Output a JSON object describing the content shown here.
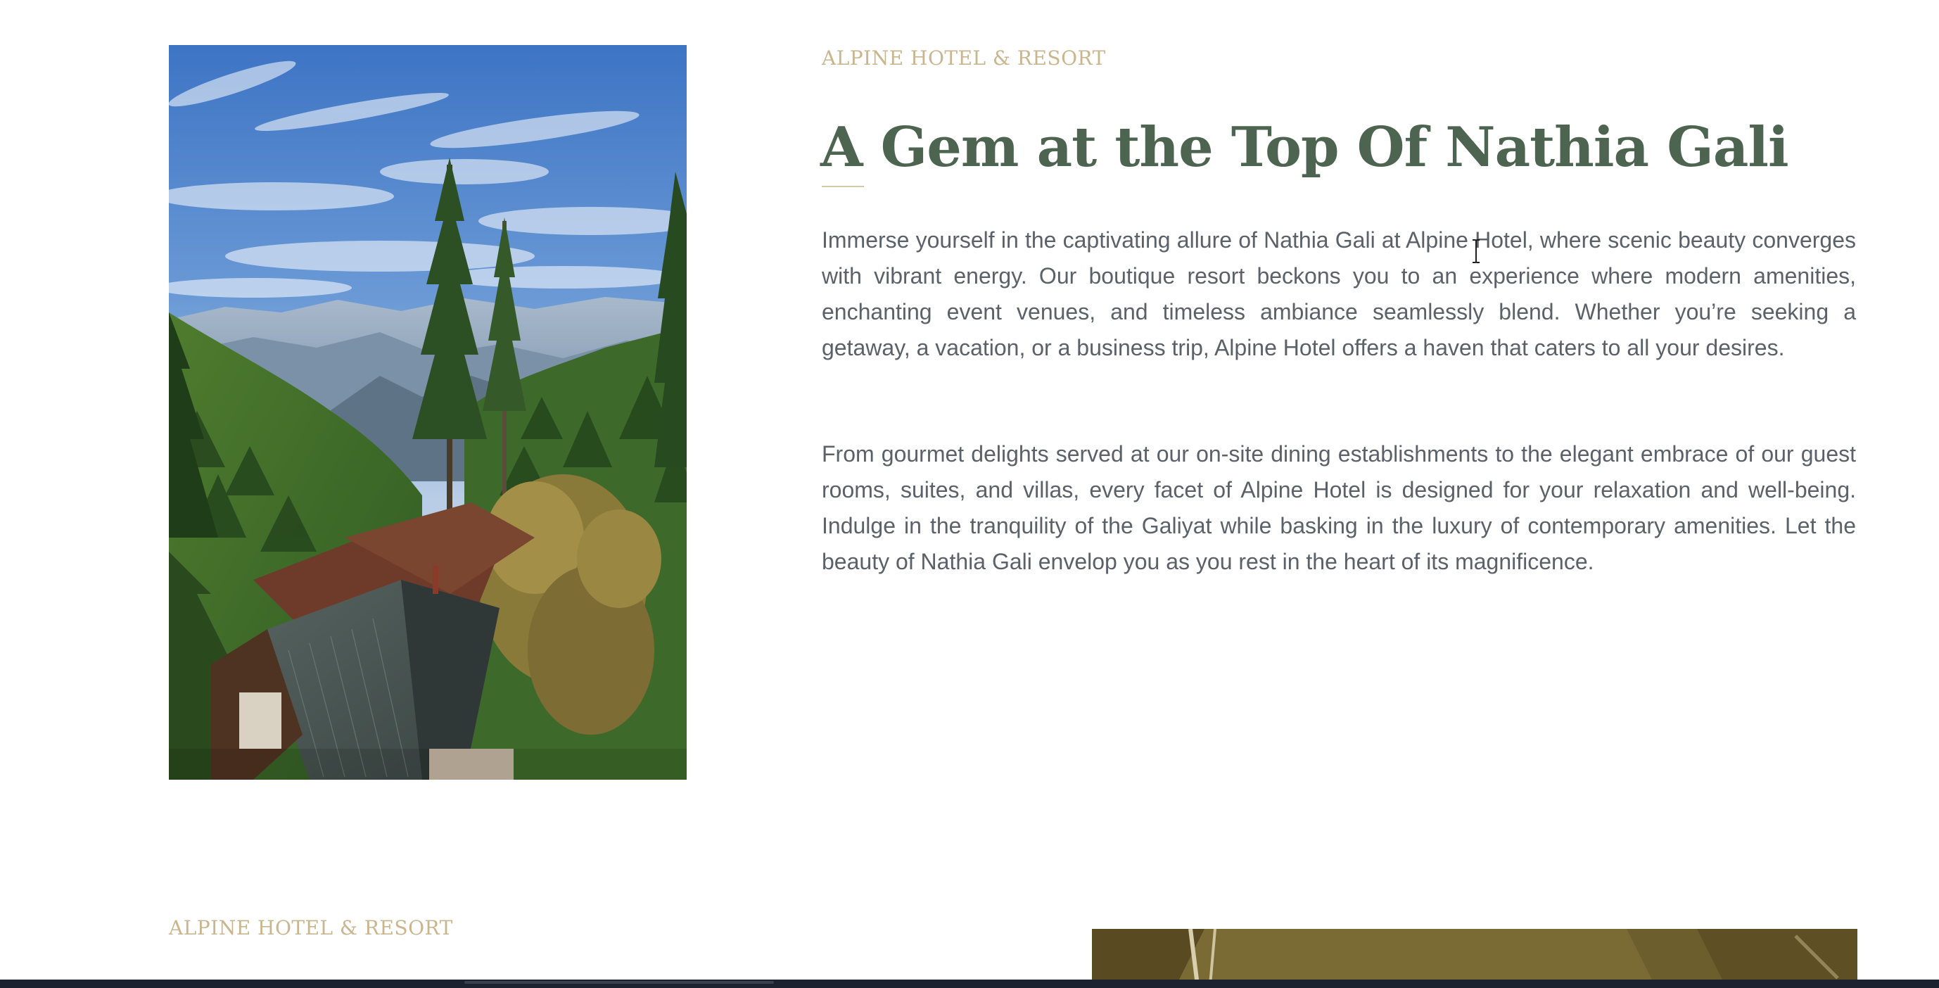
{
  "intro": {
    "eyebrow": "ALPINE HOTEL & RESORT",
    "title": "A Gem at the Top Of Nathia Gali",
    "paragraphs": [
      "Immerse yourself in the captivating allure of Nathia Gali at Alpine Hotel, where scenic beau­ty converges with vibrant energy. Our boutique resort beckons you to an experience where modern amenities, enchanting event venues, and timeless ambiance seamlessly blend. Whether you’re seeking a getaway, a vacation, or a business trip, Alpine Hotel offers a haven that caters to all your desires.",
      "From gourmet delights served at our on-site dining establishments to the elegant embrace of our guest rooms, suites, and villas, every facet of Alpine Hotel is designed for your relax­ation and well-being. Indulge in the tranquility of the Galiyat while basking in the luxury of contemporary amenities. Let the beauty of Nathia Gali envelop you as you rest in the heart of its magnificence."
    ],
    "image": {
      "description": "hotel-rooftops-among-pine-forest-photo"
    }
  },
  "next_section": {
    "eyebrow": "ALPINE HOTEL & RESORT",
    "image": {
      "description": "hotel-room-interior-photo"
    }
  },
  "colors": {
    "eyebrow": "#c9b58e",
    "headline": "#4c6450",
    "body_text": "#5b6168",
    "background": "#ffffff"
  },
  "cursor": "text-ibeam-cursor"
}
